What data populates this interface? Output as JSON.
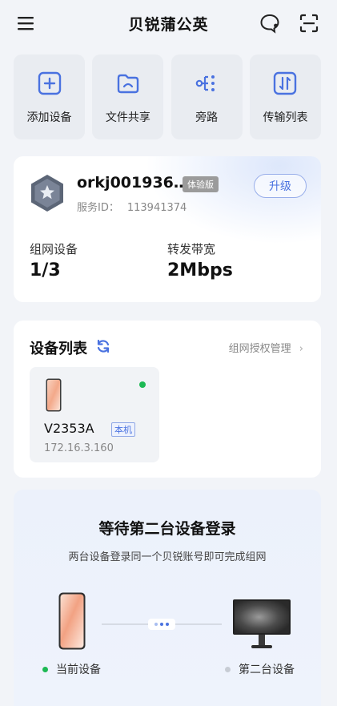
{
  "app": {
    "title": "贝锐蒲公英"
  },
  "quick_actions": [
    {
      "label": "添加设备",
      "icon": "add-device-icon"
    },
    {
      "label": "文件共享",
      "icon": "file-share-icon"
    },
    {
      "label": "旁路",
      "icon": "bypass-icon"
    },
    {
      "label": "传输列表",
      "icon": "transfer-list-icon"
    }
  ],
  "account": {
    "name": "orkj001936…",
    "tier": "体验版",
    "upgrade_label": "升级",
    "service_id_label": "服务ID：",
    "service_id": "113941374",
    "networked_label": "组网设备",
    "networked_value": "1/3",
    "bandwidth_label": "转发带宽",
    "bandwidth_value": "2Mbps"
  },
  "device_list": {
    "title": "设备列表",
    "manage_label": "组网授权管理",
    "devices": [
      {
        "name": "V2353A",
        "tag": "本机",
        "ip": "172.16.3.160",
        "status": "online"
      }
    ]
  },
  "waiting": {
    "title": "等待第二台设备登录",
    "subtitle": "两台设备登录同一个贝锐账号即可完成组网",
    "current_label": "当前设备",
    "second_label": "第二台设备"
  },
  "colors": {
    "accent": "#4a72e0",
    "online": "#1db954",
    "offline": "#c7ccd4"
  }
}
